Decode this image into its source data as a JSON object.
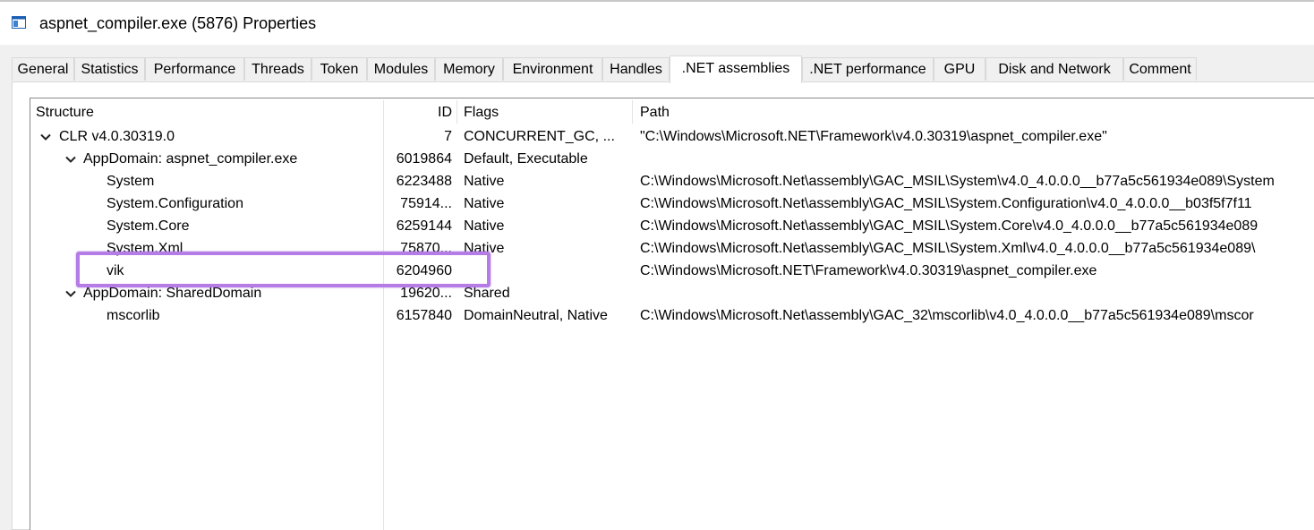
{
  "window": {
    "title": "aspnet_compiler.exe (5876) Properties",
    "icon": "window-app-icon"
  },
  "tabs": [
    {
      "label": "General"
    },
    {
      "label": "Statistics"
    },
    {
      "label": "Performance"
    },
    {
      "label": "Threads"
    },
    {
      "label": "Token"
    },
    {
      "label": "Modules"
    },
    {
      "label": "Memory"
    },
    {
      "label": "Environment"
    },
    {
      "label": "Handles"
    },
    {
      "label": ".NET assemblies",
      "active": true
    },
    {
      "label": ".NET performance"
    },
    {
      "label": "GPU"
    },
    {
      "label": "Disk and Network"
    },
    {
      "label": "Comment"
    }
  ],
  "columns": {
    "structure": "Structure",
    "id": "ID",
    "flags": "Flags",
    "path": "Path"
  },
  "rows": [
    {
      "structure": "CLR v4.0.30319.0",
      "id": "7",
      "flags": "CONCURRENT_GC, ...",
      "path": "\"C:\\Windows\\Microsoft.NET\\Framework\\v4.0.30319\\aspnet_compiler.exe\"",
      "expander": "expanded"
    },
    {
      "structure": "AppDomain: aspnet_compiler.exe",
      "id": "6019864",
      "flags": "Default, Executable",
      "path": "",
      "expander": "expanded"
    },
    {
      "structure": "System",
      "id": "6223488",
      "flags": "Native",
      "path": "C:\\Windows\\Microsoft.Net\\assembly\\GAC_MSIL\\System\\v4.0_4.0.0.0__b77a5c561934e089\\System"
    },
    {
      "structure": "System.Configuration",
      "id": "75914...",
      "flags": "Native",
      "path": "C:\\Windows\\Microsoft.Net\\assembly\\GAC_MSIL\\System.Configuration\\v4.0_4.0.0.0__b03f5f7f11"
    },
    {
      "structure": "System.Core",
      "id": "6259144",
      "flags": "Native",
      "path": "C:\\Windows\\Microsoft.Net\\assembly\\GAC_MSIL\\System.Core\\v4.0_4.0.0.0__b77a5c561934e089"
    },
    {
      "structure": "System.Xml",
      "id": "75870...",
      "flags": "Native",
      "path": "C:\\Windows\\Microsoft.Net\\assembly\\GAC_MSIL\\System.Xml\\v4.0_4.0.0.0__b77a5c561934e089\\"
    },
    {
      "structure": "vik",
      "id": "6204960",
      "flags": "",
      "path": "C:\\Windows\\Microsoft.NET\\Framework\\v4.0.30319\\aspnet_compiler.exe"
    },
    {
      "structure": "AppDomain: SharedDomain",
      "id": "19620...",
      "flags": "Shared",
      "path": "",
      "expander": "expanded"
    },
    {
      "structure": "mscorlib",
      "id": "6157840",
      "flags": "DomainNeutral, Native",
      "path": "C:\\Windows\\Microsoft.Net\\assembly\\GAC_32\\mscorlib\\v4.0_4.0.0.0__b77a5c561934e089\\mscor"
    }
  ],
  "highlight": {
    "color": "#b57be6",
    "target_row": "vik"
  },
  "colors": {
    "dialog_bg": "#f0f0f0",
    "border": "#d9d9d9"
  }
}
